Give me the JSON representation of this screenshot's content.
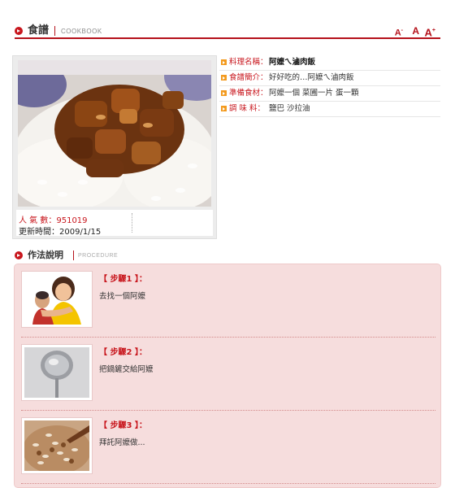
{
  "header": {
    "title": "食譜",
    "subtitle": "COOKBOOK",
    "font_decrease": "A",
    "font_normal": "A",
    "font_increase": "A",
    "font_decrease_sup": "-",
    "font_increase_sup": "+"
  },
  "photo": {
    "popularity_label": "人 氣 數：",
    "popularity_value": "951019",
    "updated_label": "更新時間：",
    "updated_value": "2009/1/15"
  },
  "details": [
    {
      "label": "料理名稱：",
      "value": "阿嬤ㄟ滷肉飯"
    },
    {
      "label": "食譜簡介：",
      "value": "好好吃的…阿嬤ㄟ滷肉飯"
    },
    {
      "label": "準備食材：",
      "value": "阿嬤一個 菜圃一片 蛋一顆"
    },
    {
      "label": "調 味 料：",
      "value": "鹽巴 沙拉油"
    }
  ],
  "procedure": {
    "title": "作法說明",
    "subtitle": "PROCEDURE",
    "steps": [
      {
        "label": "【 步驟1 】：",
        "text": "去找一個阿嬤"
      },
      {
        "label": "【 步驟2 】：",
        "text": "把鍋鏟交給阿嬤"
      },
      {
        "label": "【 步驟3 】：",
        "text": "拜託阿嬤做..."
      }
    ]
  },
  "colors": {
    "accent": "#c8161d",
    "panel": "#f6dddd",
    "bullet_orange": "#f39a1e"
  },
  "icons": [
    "section-bullet-icon",
    "detail-bullet-icon"
  ]
}
